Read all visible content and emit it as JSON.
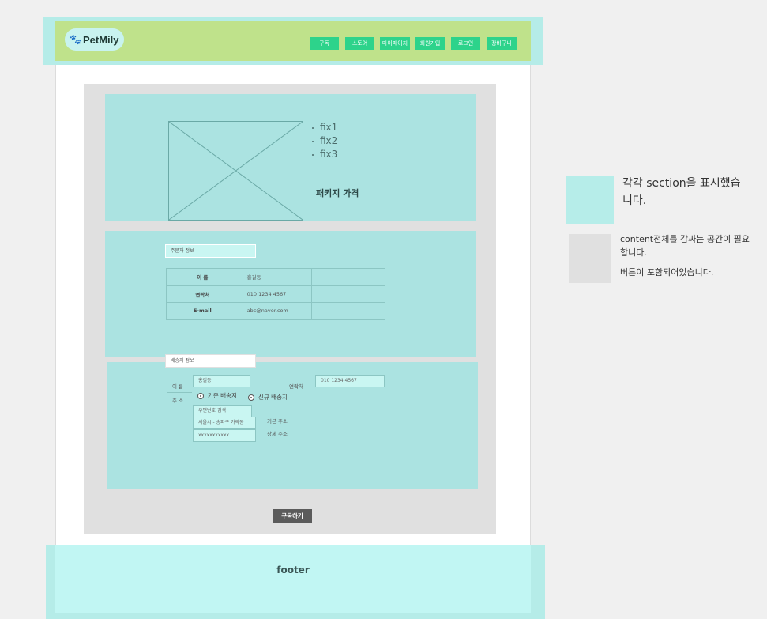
{
  "header": {
    "logo_text": "PetMily",
    "logo_icon": "paw-icon",
    "nav": [
      {
        "label": "구독"
      },
      {
        "label": "스토어"
      },
      {
        "label": "마이페이지"
      },
      {
        "label": "회원가입"
      },
      {
        "label": "로그인"
      },
      {
        "label": "장바구니"
      }
    ]
  },
  "package": {
    "fixes": [
      "fix1",
      "fix2",
      "fix3"
    ],
    "price_label": "패키지 가격",
    "image_icon": "image-placeholder-icon"
  },
  "orderer": {
    "section_label": "주문자 정보",
    "rows": [
      {
        "key": "이 름",
        "value": "홍길동"
      },
      {
        "key": "연락처",
        "value": "010 1234 4567"
      },
      {
        "key": "E-mail",
        "value": "abc@naver.com"
      }
    ]
  },
  "shipping": {
    "section_label": "배송지 정보",
    "name_label": "이 름",
    "name_value": "홍길동",
    "contact_label": "연락처",
    "contact_value": "010 1234 4567",
    "address_label": "주 소",
    "radio_existing": "기존 배송지",
    "radio_new": "신규 배송지",
    "zip_search": "우편번호 검색",
    "address1": "서울시 - 송파구 가락동",
    "address2": "xxxxxxxxxxx",
    "address1_label": "기본 주소",
    "address2_label": "상세 주소"
  },
  "subscribe_button": "구독하기",
  "footer": {
    "text": "footer"
  },
  "legend": {
    "section_note": "각각 section을 표시했습니다.",
    "content_note": "content전체를 감싸는 공간이 필요합니다.",
    "button_note": "버튼이 포함되어있습니다."
  },
  "colors": {
    "header_bg": "#bfe28b",
    "section_bg": "#abe3e1",
    "nav_button": "#2dd38b",
    "content_wrap": "#e0e0e0",
    "subscribe_button": "#5b5b5b"
  }
}
